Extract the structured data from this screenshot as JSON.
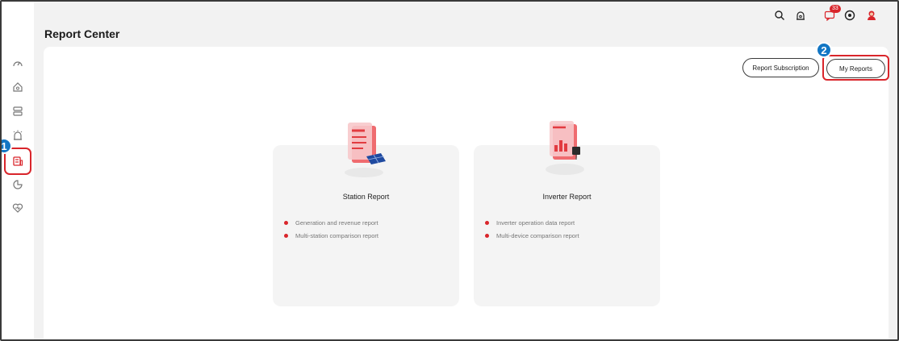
{
  "page": {
    "title": "Report Center"
  },
  "sidebar": {
    "items": [
      {
        "name": "dashboard-icon"
      },
      {
        "name": "home-icon"
      },
      {
        "name": "device-list-icon"
      },
      {
        "name": "alarm-icon"
      },
      {
        "name": "report-icon",
        "active": true
      },
      {
        "name": "statistics-icon"
      },
      {
        "name": "maintenance-icon"
      }
    ]
  },
  "topbar": {
    "icons": [
      "search-icon",
      "alarm-icon",
      "message-icon",
      "help-icon",
      "user-avatar"
    ],
    "message_badge": "33"
  },
  "toolbar": {
    "subscription_label": "Report Subscription",
    "my_reports_label": "My Reports"
  },
  "annotations": {
    "step1": "1",
    "step2": "2"
  },
  "cards": [
    {
      "title": "Station Report",
      "items": [
        "Generation and revenue report",
        "Multi-station comparison report"
      ]
    },
    {
      "title": "Inverter Report",
      "items": [
        "Inverter operation data report",
        "Multi-device comparison report"
      ]
    }
  ],
  "colors": {
    "accent": "#d9252b",
    "step_badge": "#1276c4"
  }
}
